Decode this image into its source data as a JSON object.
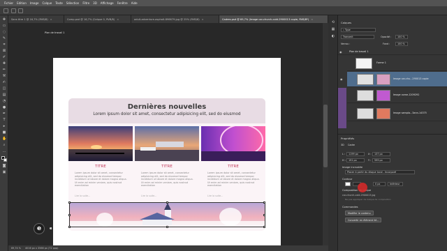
{
  "menubar": {
    "items": [
      "Fichier",
      "Edition",
      "Image",
      "Calque",
      "Texte",
      "Sélection",
      "Filtre",
      "3D",
      "Affichage",
      "Fenêtre",
      "Aide"
    ]
  },
  "tabs": [
    {
      "label": "Sans titre 1 @ 16,7% (RVB/8)",
      "active": false
    },
    {
      "label": "Comp.psd @ 16,7% (Calque 0, RVB/8)",
      "active": false
    },
    {
      "label": "adult-adventure-asphalt-896679.jpg @ 25% (RVB/8)",
      "active": false
    },
    {
      "label": "Cadres.psd @ 69,7% (Image car-church-cold-2900013 copie, RVB/8*)",
      "active": true
    }
  ],
  "canvas": {
    "artboard_label": "Plan de travail 1",
    "news_title": "Dernières nouvelles",
    "news_subtitle": "Lorem ipsum dolor sit amet, consectetur adipisicing elit, sed do eiusmod",
    "columns": [
      {
        "title": "TITRE",
        "text": "Lorem ipsum dolor sit amet, consectetur adipisicing elit, sed do eiusmod tempor incididunt ut labore et dolore magna aliqua. Ut enim ad minim veniam, quis nostrud exercitation",
        "link": "Lire la suite..."
      },
      {
        "title": "TITRE",
        "text": "Lorem ipsum dolor sit amet, consectetur adipisicing elit, sed do eiusmod tempor incididunt ut labore et dolore magna aliqua. Ut enim ad minim veniam, quis nostrud exercitation",
        "link": "Lire la suite..."
      },
      {
        "title": "TITRE",
        "text": "Lorem ipsum dolor sit amet, consectetur adipisicing elit, sed do eiusmod tempor incididunt ut labore et dolore magna aliqua. Ut enim ad minim veniam, quis nostrud exercitation",
        "link": "Lire la suite..."
      }
    ],
    "logo_letter": "e",
    "logo_text": "e"
  },
  "status": {
    "zoom": "69,74 %",
    "doc_info": "4016 px x 3566 px (72 ppp)"
  },
  "panel": {
    "layers_tab": "Calques",
    "kind_filter": "Type",
    "blend_mode": "Transmit",
    "opacity_label": "Opacité :",
    "opacity_value": "100 %",
    "lock_label": "Verrou :",
    "fill_label": "Fond :",
    "fill_value": "100 %",
    "layers": [
      {
        "name": "Plan de travail 1",
        "type": "group"
      },
      {
        "name": "Forme 1",
        "type": "shape"
      },
      {
        "name": "Image car-chu...290013 copie",
        "type": "selected"
      },
      {
        "name": "Image come-1209292",
        "type": "purple"
      },
      {
        "name": "Image sampla...3ann-14375",
        "type": "purple"
      }
    ],
    "properties_tab": "Propriétés",
    "props_sub_tabs": [
      "3D",
      "Cadre"
    ],
    "w_label": "L :",
    "w_value": "1199 px",
    "h_label": "H :",
    "h_value": "191 px",
    "x_label": "X :",
    "x_value": "137 px",
    "y_label": "Y :",
    "y_value": "599 px",
    "embedded_label": "Image incrustée",
    "embedded_option": "Placer à partir du disque local - Incorporé",
    "stroke_label": "Contour",
    "stroke_size": "0 px",
    "stroke_pos": "Intérieur",
    "composition_label": "Composition de calque",
    "composition_file": "car-church-cold-2900013.jpg",
    "composition_note": "Ne pas appliquer de Calque de composition",
    "commands_label": "Commandes",
    "btn_modify": "Modifier le contenu",
    "btn_convert": "Convertir en élément lié..."
  }
}
